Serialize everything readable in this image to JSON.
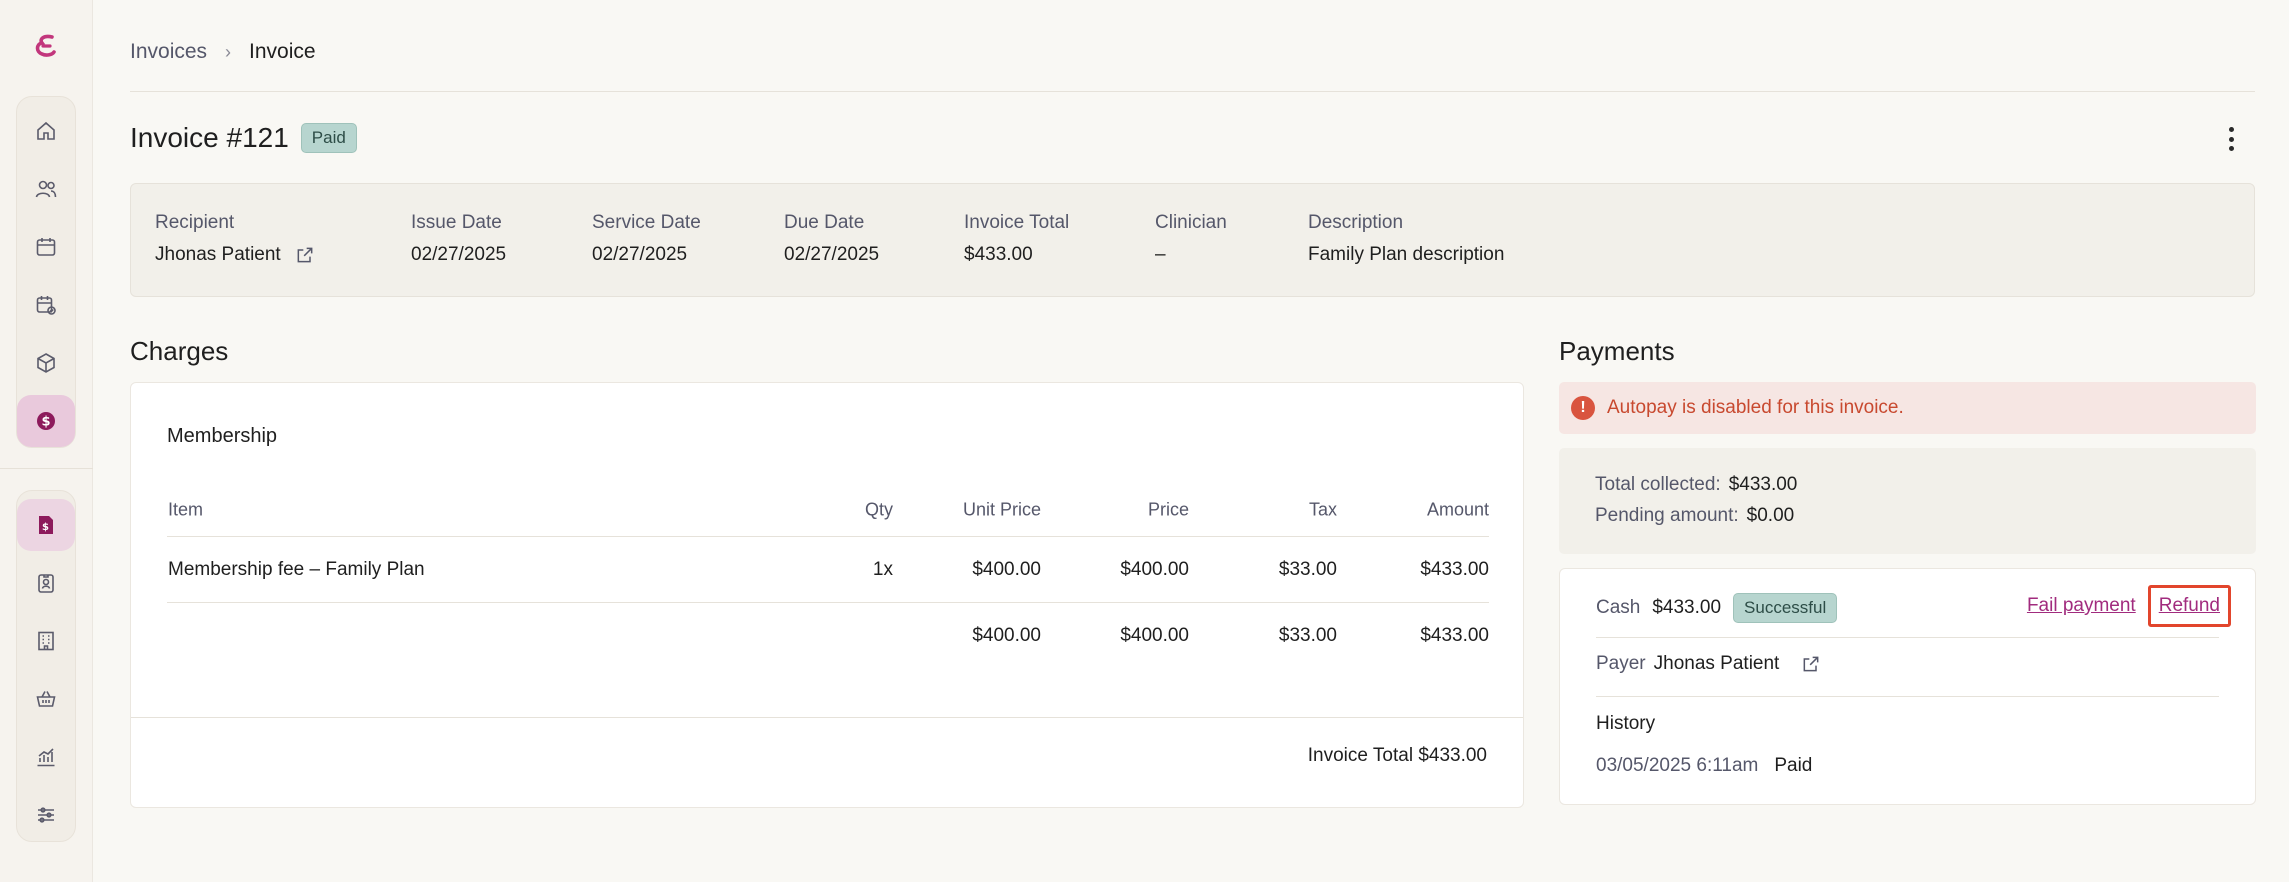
{
  "breadcrumb": {
    "parent": "Invoices",
    "current": "Invoice"
  },
  "invoice": {
    "title": "Invoice #121",
    "status": "Paid",
    "summary": {
      "recipient_label": "Recipient",
      "recipient_value": "Jhonas Patient",
      "issue_label": "Issue Date",
      "issue_value": "02/27/2025",
      "service_label": "Service Date",
      "service_value": "02/27/2025",
      "due_label": "Due Date",
      "due_value": "02/27/2025",
      "total_label": "Invoice Total",
      "total_value": "$433.00",
      "clinician_label": "Clinician",
      "clinician_value": "–",
      "description_label": "Description",
      "description_value": "Family Plan description"
    }
  },
  "charges": {
    "title": "Charges",
    "subtitle": "Membership",
    "columns": [
      "Item",
      "Qty",
      "Unit Price",
      "Price",
      "Tax",
      "Amount"
    ],
    "rows": [
      {
        "item": "Membership fee – Family Plan",
        "qty": "1x",
        "unit_price": "$400.00",
        "price": "$400.00",
        "tax": "$33.00",
        "amount": "$433.00"
      }
    ],
    "totals": {
      "unit_price": "$400.00",
      "price": "$400.00",
      "tax": "$33.00",
      "amount": "$433.00"
    },
    "footer": "Invoice Total $433.00"
  },
  "payments": {
    "title": "Payments",
    "alert": "Autopay is disabled for this invoice.",
    "collected_label": "Total collected:",
    "collected_value": "$433.00",
    "pending_label": "Pending amount:",
    "pending_value": "$0.00",
    "method": "Cash",
    "amount": "$433.00",
    "status": "Successful",
    "fail_link": "Fail payment",
    "refund_link": "Refund",
    "payer_label": "Payer",
    "payer_value": "Jhonas Patient",
    "history_title": "History",
    "history_time": "03/05/2025 6:11am",
    "history_status": "Paid"
  },
  "colors": {
    "accent": "#a12b7e",
    "success_bg": "#b7d5cf",
    "alert": "#d9543f"
  },
  "icons": {
    "sidebar": [
      "home-icon",
      "users-icon",
      "calendar-icon",
      "calendar-check-icon",
      "box-icon",
      "dollar-icon",
      "invoice-icon",
      "id-badge-icon",
      "building-icon",
      "basket-icon",
      "chart-icon",
      "sliders-icon"
    ]
  }
}
